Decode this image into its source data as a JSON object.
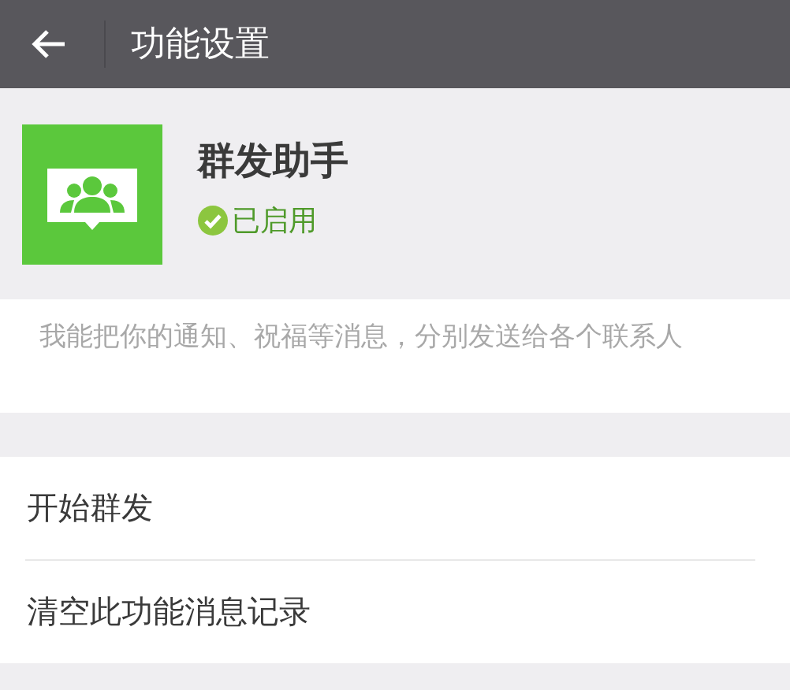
{
  "header": {
    "title": "功能设置"
  },
  "feature": {
    "name": "群发助手",
    "status": "已启用",
    "enabled": true
  },
  "description": "我能把你的通知、祝福等消息，分别发送给各个联系人",
  "actions": [
    {
      "label": "开始群发"
    },
    {
      "label": "清空此功能消息记录"
    }
  ]
}
